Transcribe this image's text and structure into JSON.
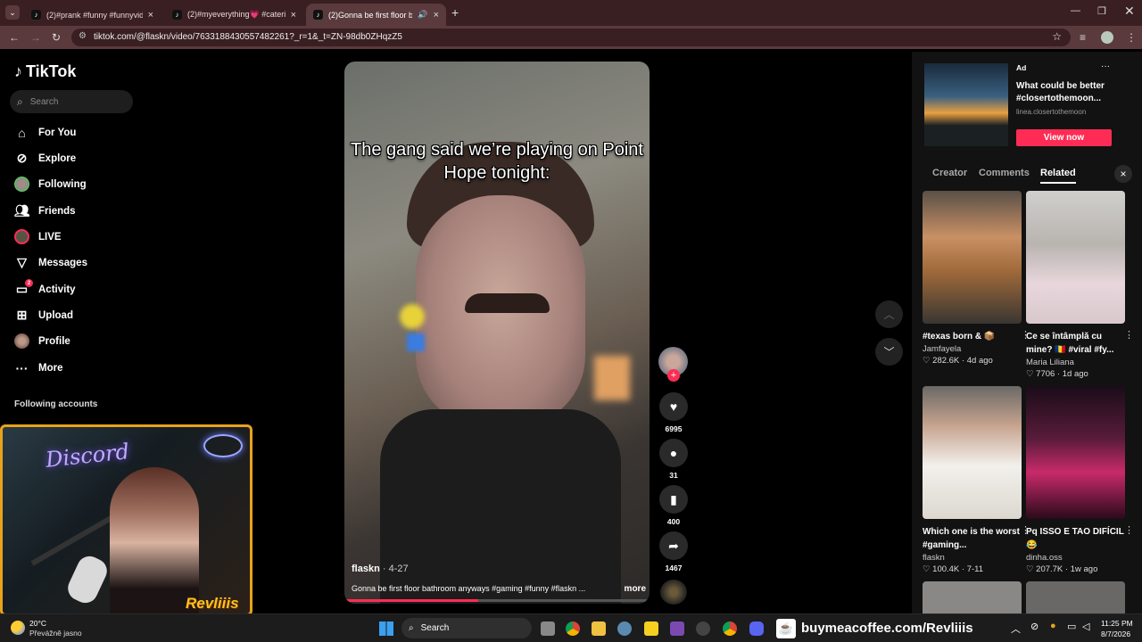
{
  "tabs": [
    {
      "title": "(2)#prank #funny #funnyvideo",
      "close": "×"
    },
    {
      "title": "(2)#myeverything💗 #caterinca",
      "close": "×"
    },
    {
      "title": "(2)Gonna be first floor bath",
      "close": "×"
    }
  ],
  "new_tab": "+",
  "address": "tiktok.com/@flaskn/video/7633188430557482261?_r=1&_t=ZN-98db0ZHqzZ5",
  "logo": "TikTok",
  "search_placeholder": "Search",
  "nav": [
    {
      "label": "For You",
      "icon": "home-icon"
    },
    {
      "label": "Explore",
      "icon": "compass-icon"
    },
    {
      "label": "Following",
      "icon": "following-avatar-icon"
    },
    {
      "label": "Friends",
      "icon": "friends-icon"
    },
    {
      "label": "LIVE",
      "icon": "live-icon"
    },
    {
      "label": "Messages",
      "icon": "messages-icon"
    },
    {
      "label": "Activity",
      "icon": "activity-icon",
      "badge": "2"
    },
    {
      "label": "Upload",
      "icon": "upload-icon"
    },
    {
      "label": "Profile",
      "icon": "profile-avatar-icon"
    },
    {
      "label": "More",
      "icon": "more-icon"
    }
  ],
  "following_accounts": "Following accounts",
  "webcam": {
    "neon": "Discord",
    "brand": "Revliiis"
  },
  "video": {
    "caption": "The gang said we’re playing on Point Hope tonight:",
    "author": "flaskn",
    "date": " · 4-27",
    "description": "Gonna be first floor bathroom anyways #gaming #funny #flaskn ...",
    "more": "more",
    "progress": 0.44
  },
  "actions": {
    "likes": "6995",
    "comments": "31",
    "saves": "400",
    "shares": "1467"
  },
  "ad": {
    "tag": "Ad",
    "title": "What could be better #closertothemoon...",
    "domain": "linea.closertothemoon",
    "cta": "View now",
    "menu": "···"
  },
  "right_tabs": [
    "Creator",
    "Comments",
    "Related"
  ],
  "close_panel": "×",
  "related": [
    {
      "title": "#texas born & 📦",
      "author": "Jamfayela",
      "likes": "282.6K",
      "age": "4d ago"
    },
    {
      "title": "Ce se întâmplă cu mine? 🇷🇴 #viral #fy...",
      "author": "Maria Liliana",
      "likes": "7706",
      "age": "1d ago"
    },
    {
      "title": "Which one is the worst #gaming...",
      "author": "flaskn",
      "likes": "100.4K",
      "age": "7-11"
    },
    {
      "title": "Pq ISSO E TAO DIFÍCIL 😂",
      "author": "dinha.oss",
      "likes": "207.7K",
      "age": "1w ago"
    }
  ],
  "taskbar": {
    "weather_temp": "20°C",
    "weather_desc": "Převážně jasno",
    "search": "Search",
    "coffee": "buymeacoffee.com/Revliiis",
    "time": "11:25 PM",
    "date": "8/7/2026"
  },
  "colors": {
    "accent": "#fe2c55",
    "chrome": "#3a1f22",
    "webcam_border": "#e8a21c"
  }
}
